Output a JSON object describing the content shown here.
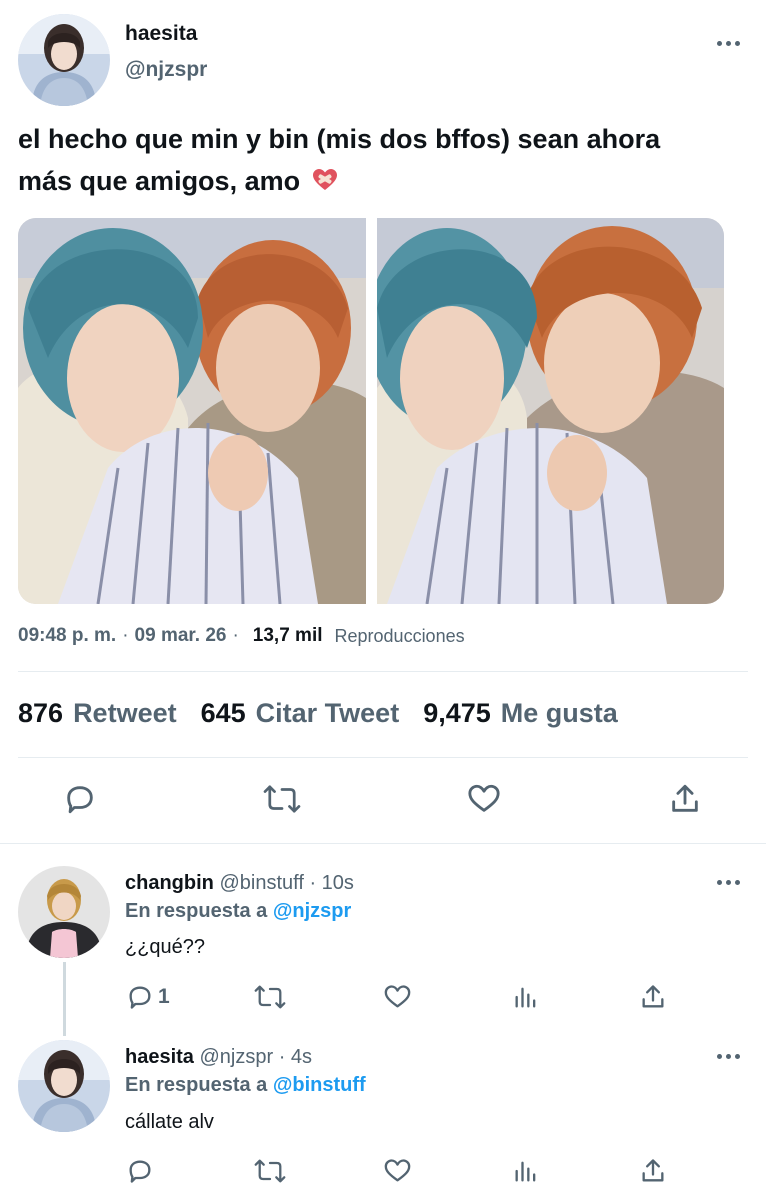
{
  "main_tweet": {
    "display_name": "haesita",
    "handle": "@njzspr",
    "text_line1": "el hecho que min y bin (mis dos bffos) sean ahora",
    "text_line2": "más que amigos, amo",
    "emoji": "mending-heart-icon",
    "time": "09:48 p. m.",
    "date": "09 mar. 26",
    "views": "13,7 mil",
    "views_label": "Reproducciones",
    "stats": {
      "retweets": "876",
      "retweets_label": "Retweet",
      "quotes": "645",
      "quotes_label": "Citar Tweet",
      "likes": "9,475",
      "likes_label": "Me gusta"
    }
  },
  "replies": [
    {
      "display_name": "changbin",
      "handle": "@binstuff",
      "time": "· 10s",
      "in_reply_label": "En respuesta a",
      "in_reply_to": "@njzspr",
      "text": "¿¿qué??",
      "reply_count": "1"
    },
    {
      "display_name": "haesita",
      "handle": "@njzspr",
      "time": "· 4s",
      "in_reply_label": "En respuesta a",
      "in_reply_to": "@binstuff",
      "text": "cállate alv"
    }
  ],
  "colors": {
    "text": "#0f1419",
    "secondary": "#536471",
    "accent": "#1d9bf0",
    "divider": "#e6ecf0"
  }
}
